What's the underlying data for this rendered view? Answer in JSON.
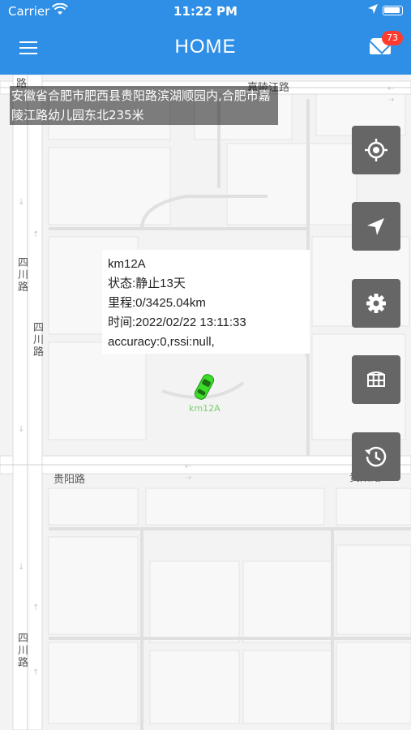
{
  "status_bar": {
    "carrier": "Carrier",
    "time": "11:22 PM"
  },
  "nav": {
    "title": "HOME",
    "badge_count": "73"
  },
  "map": {
    "address": "安徽省合肥市肥西县贵阳路滨湖顺园内,合肥市嘉陵江路幼儿园东北235米",
    "street_labels": {
      "jialingjiang_top": "嘉陵江路",
      "sihui_upper": "四川路",
      "sihui_mid": "四川路",
      "guiyang_left": "贵阳路",
      "guiyang_right": "贵阳路",
      "sihui_lower": "四川路",
      "top_left_fragment": "路"
    },
    "vehicle_label": "km12A"
  },
  "popup": {
    "name": "km12A",
    "status": "状态:静止13天",
    "mileage": "里程:0/3425.04km",
    "time": "时间:2022/02/22 13:11:33",
    "accuracy": "accuracy:0,rssi:null,"
  },
  "buttons": {
    "locate_icon": "crosshair-icon",
    "navigate_icon": "navigation-arrow-icon",
    "settings_icon": "gear-icon",
    "grid_icon": "fence-grid-icon",
    "history_icon": "history-icon"
  },
  "colors": {
    "header": "#2f8fe6",
    "badge": "#ff3b30",
    "button": "#666666",
    "vehicle": "#3ddc2a"
  }
}
